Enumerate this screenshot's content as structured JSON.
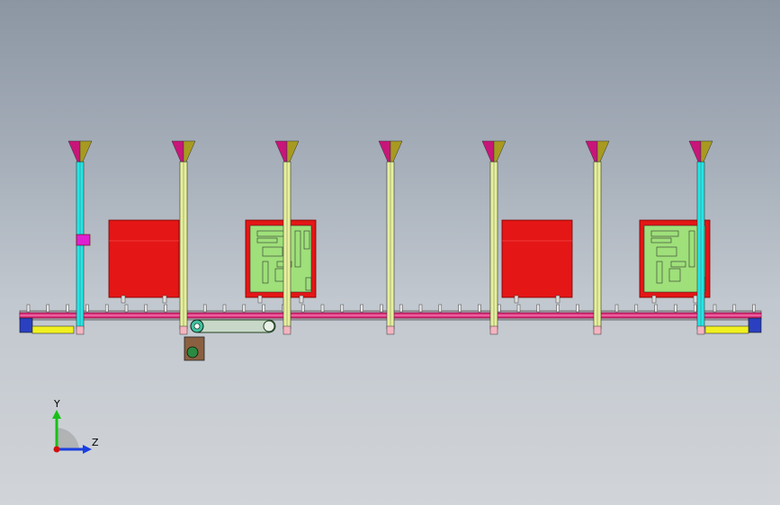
{
  "app": {
    "view": "cad-model-viewport"
  },
  "triad": {
    "y_label": "Y",
    "z_label": "Z",
    "y_color": "#18c018",
    "z_color": "#1a3fe0",
    "origin_color": "#d01010"
  },
  "colors": {
    "post_cyan": "#22e6e6",
    "post_yellow": "#e6f09a",
    "funnel_pink": "#c8157a",
    "funnel_olive": "#a89a20",
    "rail": "#d8307a",
    "block_red": "#e41616",
    "panel_green": "#9fe07a",
    "frame_yellow": "#f0f020",
    "frame_blue": "#2a40c0",
    "foot_pink": "#f4b4c0"
  },
  "posts": [
    {
      "kind": "cyan"
    },
    {
      "kind": "yellow"
    },
    {
      "kind": "yellow"
    },
    {
      "kind": "yellow"
    },
    {
      "kind": "yellow"
    },
    {
      "kind": "yellow"
    },
    {
      "kind": "cyan"
    }
  ],
  "blocks": [
    {
      "kind": "solid-red"
    },
    {
      "kind": "circuit-panel"
    },
    {
      "kind": "solid-red"
    },
    {
      "kind": "circuit-panel"
    }
  ]
}
